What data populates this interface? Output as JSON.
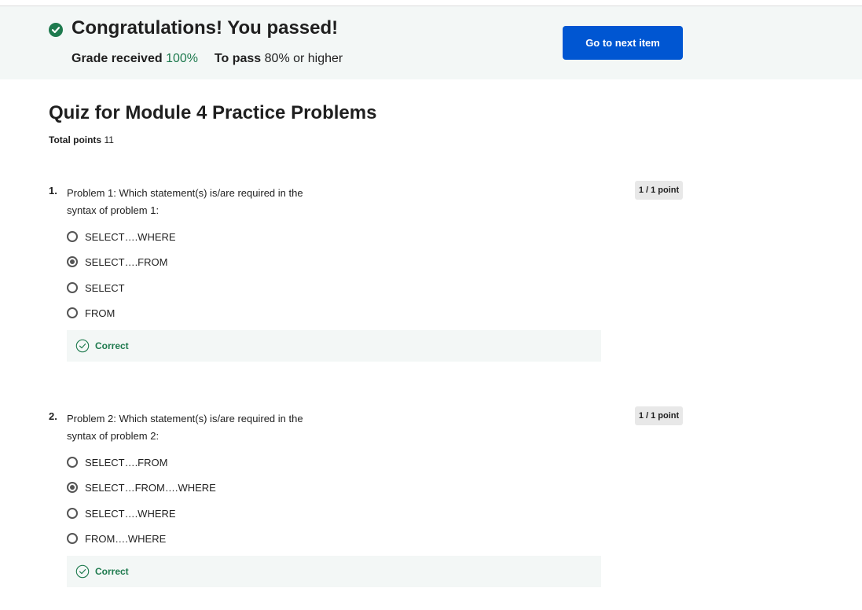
{
  "banner": {
    "title": "Congratulations! You passed!",
    "grade_label": "Grade received",
    "grade_value": "100%",
    "pass_label": "To pass",
    "pass_value": "80% or higher",
    "next_button": "Go to next item"
  },
  "quiz": {
    "title": "Quiz for Module 4 Practice Problems",
    "total_label": "Total points",
    "total_value": "11"
  },
  "questions": [
    {
      "number": "1.",
      "text": "Problem 1: Which statement(s) is/are required in the syntax of problem 1:",
      "points": "1 / 1 point",
      "options": [
        "SELECT….WHERE",
        "SELECT….FROM",
        "SELECT",
        "FROM"
      ],
      "selected_index": 1,
      "feedback": "Correct"
    },
    {
      "number": "2.",
      "text": "Problem 2: Which statement(s) is/are required in the syntax of problem 2:",
      "points": "1 / 1 point",
      "options": [
        "SELECT….FROM",
        "SELECT…FROM….WHERE",
        "SELECT….WHERE",
        "FROM….WHERE"
      ],
      "selected_index": 1,
      "feedback": "Correct"
    }
  ],
  "colors": {
    "accent": "#0056d2",
    "success": "#1e7a4e",
    "banner_bg": "#f3f7f6"
  },
  "icons": {
    "banner": "check-circle-filled-icon",
    "feedback": "check-circle-outline-icon"
  }
}
